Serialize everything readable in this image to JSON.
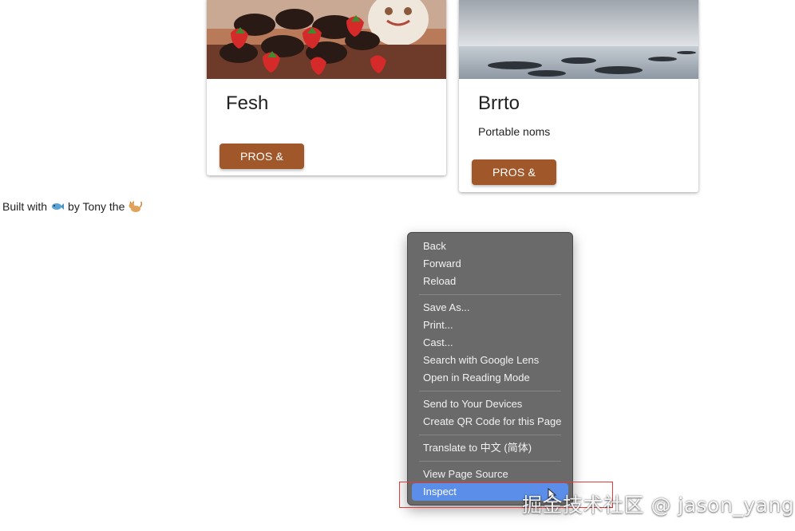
{
  "cards": [
    {
      "title": "Fesh",
      "description": "",
      "button_label": "PROS & CONS"
    },
    {
      "title": "Brrto",
      "description": "Portable noms",
      "button_label": "PROS & CONS"
    }
  ],
  "footer": {
    "prefix": "Built with",
    "middle": "by Tony the",
    "icons": [
      "fish-emoji-icon",
      "cat-emoji-icon"
    ]
  },
  "context_menu": {
    "group1": [
      "Back",
      "Forward",
      "Reload"
    ],
    "group2": [
      "Save As...",
      "Print...",
      "Cast...",
      "Search with Google Lens",
      "Open in Reading Mode"
    ],
    "group3": [
      "Send to Your Devices",
      "Create QR Code for this Page"
    ],
    "group4": [
      "Translate to 中文 (简体)"
    ],
    "group5": [
      "View Page Source",
      "Inspect"
    ],
    "highlighted": "Inspect",
    "highlight_color": "#5a8ee8"
  },
  "annotation": {
    "box_color": "#e33a3a"
  },
  "watermark": "掘金技术社区 @ jason_yang",
  "colors": {
    "button": "#a0582b",
    "menu_bg": "#6a6a6a"
  }
}
